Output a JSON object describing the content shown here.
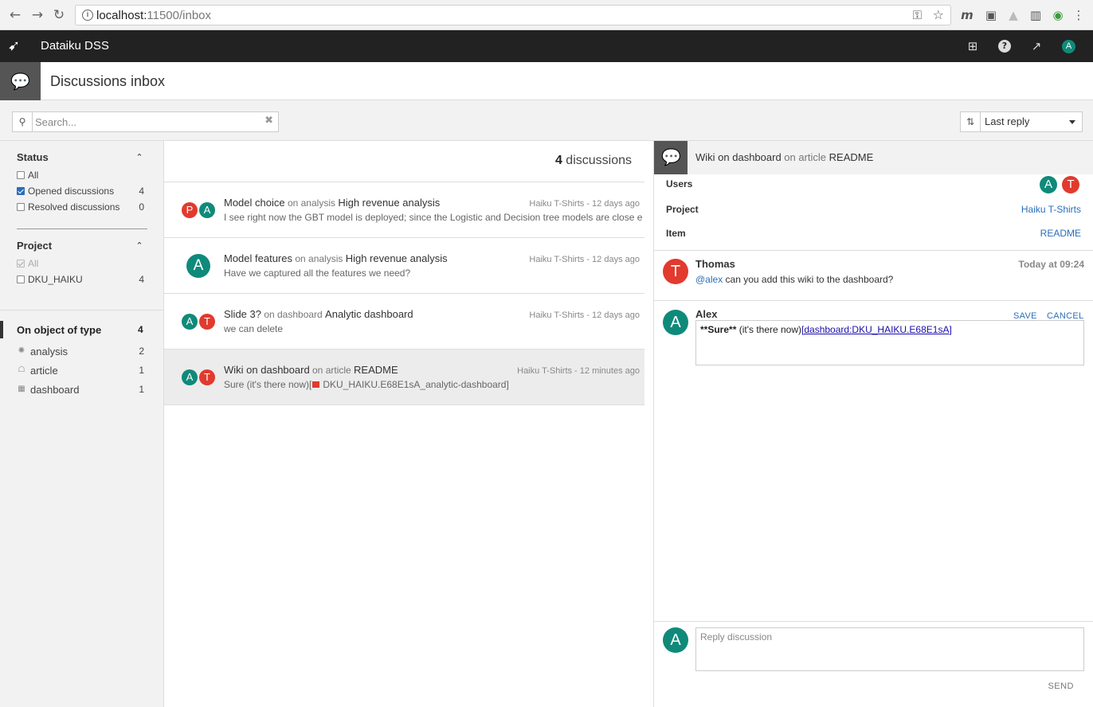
{
  "browser": {
    "url_host": "localhost:",
    "url_path": "11500/inbox",
    "back_icon": "←",
    "forward_icon": "→",
    "reload_icon": "↻",
    "ext_m": "m"
  },
  "app": {
    "name": "Dataiku DSS",
    "avatar": "A",
    "help": "?"
  },
  "page": {
    "title": "Discussions inbox"
  },
  "search": {
    "placeholder": "Search..."
  },
  "sort": {
    "selected": "Last reply"
  },
  "filters": {
    "status": {
      "title": "Status",
      "items": [
        {
          "label": "All",
          "count": ""
        },
        {
          "label": "Opened discussions",
          "count": "4"
        },
        {
          "label": "Resolved discussions",
          "count": "0"
        }
      ]
    },
    "project": {
      "title": "Project",
      "items": [
        {
          "label": "All",
          "count": ""
        },
        {
          "label": "DKU_HAIKU",
          "count": "4"
        }
      ]
    },
    "object_type": {
      "title": "On object of type",
      "count": "4",
      "items": [
        {
          "label": "analysis",
          "count": "2"
        },
        {
          "label": "article",
          "count": "1"
        },
        {
          "label": "dashboard",
          "count": "1"
        }
      ]
    }
  },
  "list": {
    "count": "4",
    "count_label": " discussions",
    "items": [
      {
        "avatars": [
          "P",
          "A"
        ],
        "title": "Model choice",
        "on": " on analysis ",
        "object": "High revenue analysis",
        "meta": "Haiku T-Shirts - 12 days ago",
        "snippet": "I see right now the GBT model is deployed; since the Logistic and Decision tree models are close e"
      },
      {
        "avatars": [
          "A"
        ],
        "title": "Model features",
        "on": " on analysis ",
        "object": "High revenue analysis",
        "meta": "Haiku T-Shirts - 12 days ago",
        "snippet": "Have we captured all the features we need?"
      },
      {
        "avatars": [
          "A",
          "T"
        ],
        "title": "Slide 3?",
        "on": " on dashboard ",
        "object": "Analytic dashboard",
        "meta": "Haiku T-Shirts - 12 days ago",
        "snippet": "we can delete"
      },
      {
        "avatars": [
          "A",
          "T"
        ],
        "title": "Wiki on dashboard",
        "on": " on article ",
        "object": "README",
        "meta": "Haiku T-Shirts - 12 minutes ago",
        "snippet_pre": "Sure (it's there now)[",
        "snippet_post": "DKU_HAIKU.E68E1sA_analytic-dashboard]"
      }
    ]
  },
  "detail": {
    "title": "Wiki on dashboard",
    "on": " on article ",
    "object": "README",
    "users_label": "Users",
    "users": [
      "A",
      "T"
    ],
    "project_label": "Project",
    "project_value": "Haiku T-Shirts",
    "item_label": "Item",
    "item_value": "README",
    "messages": [
      {
        "avatar": "T",
        "author": "Thomas",
        "time": "Today at 09:24",
        "mention": "@alex",
        "text": " can you add this wiki to the dashboard?"
      },
      {
        "avatar": "A",
        "author": "Alex",
        "save": "SAVE",
        "cancel": "CANCEL",
        "edit_bold": "**Sure**",
        "edit_text": "  (it's there now)",
        "edit_link": "[dashboard:DKU_HAIKU.E68E1sA]"
      }
    ],
    "reply": {
      "avatar": "A",
      "placeholder": "Reply discussion",
      "send": "SEND"
    }
  },
  "colors": {
    "teal": "#0f8a7a",
    "red": "#e23a2e",
    "link": "#2a6ebb",
    "header": "#222222"
  },
  "icons": {
    "logo": "bird-logo-icon",
    "apps": "grid-icon",
    "help": "help-icon",
    "trend": "trend-icon",
    "discussions": "chat-bubbles-icon",
    "search": "search-icon",
    "sort": "sort-icon",
    "clear": "clear-icon"
  }
}
